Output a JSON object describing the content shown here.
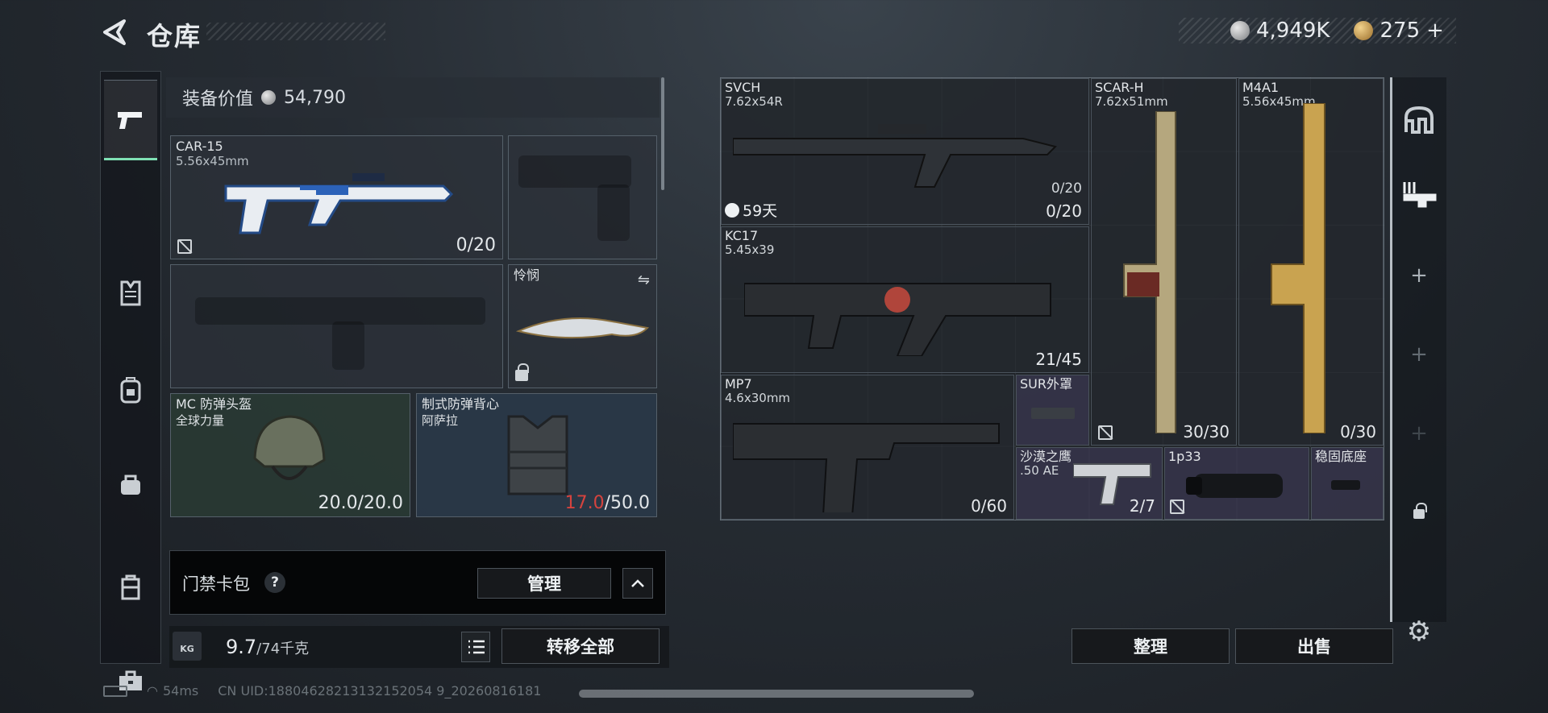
{
  "header": {
    "title": "仓库",
    "silver": "4,949K",
    "gold": "275",
    "gold_plus": "+"
  },
  "rail": [
    "pistol-icon",
    "vest-rig-icon",
    "backpack-icon",
    "pouch-icon",
    "case-icon",
    "toolbox-icon"
  ],
  "loadout": {
    "value_label": "装备价值",
    "value": "54,790",
    "primary": {
      "name": "CAR-15",
      "caliber": "5.56x45mm",
      "count": "0/20"
    },
    "melee": {
      "name": "怜悯"
    },
    "helmet": {
      "name": "MC 防弹头盔",
      "brand": "全球力量",
      "durability": "20.0/20.0"
    },
    "armor": {
      "name": "制式防弹背心",
      "brand": "阿萨拉",
      "durability_current": "17.0",
      "durability_max": "/50.0"
    }
  },
  "cardpack": {
    "label": "门禁卡包",
    "help": "?",
    "manage": "管理",
    "collapse": "^"
  },
  "weight": {
    "current": "9.7",
    "max": "/74千克",
    "transfer_all": "转移全部",
    "kg": "KG"
  },
  "stash": {
    "items": [
      {
        "name": "SVCH",
        "caliber": "7.62x54R",
        "count_small": "0/20",
        "count": "0/20",
        "timer": "59天"
      },
      {
        "name": "KC17",
        "caliber": "5.45x39",
        "count": "21/45"
      },
      {
        "name": "SCAR-H",
        "caliber": "7.62x51mm",
        "count": "30/30"
      },
      {
        "name": "M4A1",
        "caliber": "5.56x45mm",
        "count": "0/30"
      },
      {
        "name": "MP7",
        "caliber": "4.6x30mm",
        "count": "0/60"
      },
      {
        "name": "SUR外罩"
      },
      {
        "name": "沙漠之鹰",
        "caliber": ".50 AE",
        "count": "2/7"
      },
      {
        "name": "1p33"
      },
      {
        "name": "稳固底座"
      }
    ],
    "sort": "整理",
    "sell": "出售"
  },
  "status": {
    "ping": "54ms",
    "uid": "CN UID:18804628213132152054 9_20260816181"
  }
}
